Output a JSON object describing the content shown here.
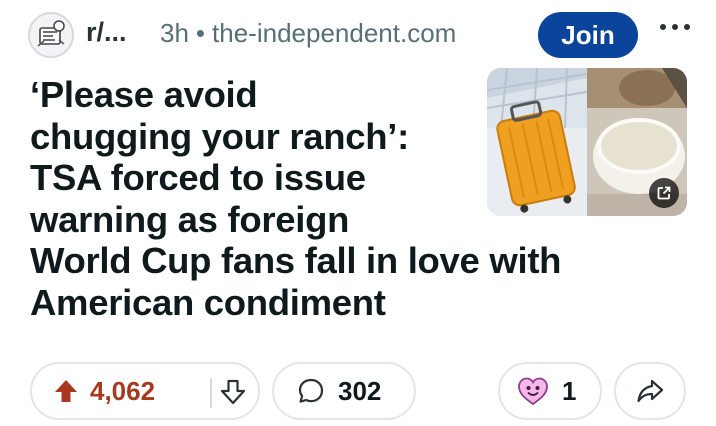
{
  "post": {
    "subreddit": "r/...",
    "age": "3h",
    "separator": "•",
    "domain": "the-independent.com",
    "join_label": "Join",
    "title_lines": [
      "‘Please avoid",
      "chugging your ranch’:",
      "TSA forced to issue",
      "warning as foreign",
      "World Cup fans fall in love with",
      "American condiment"
    ]
  },
  "actions": {
    "upvotes": "4,062",
    "comments": "302",
    "awards": "1"
  },
  "colors": {
    "join_bg": "#0a449b",
    "upvote_accent": "#a9391e",
    "pill_border": "#e3e6e8",
    "meta_text": "#576f76"
  },
  "icons": {
    "subreddit_avatar": "subreddit-avatar-icon",
    "more": "more-dots-icon",
    "external_link": "external-link-icon",
    "upvote": "upvote-arrow-icon",
    "downvote": "downvote-arrow-icon",
    "comment": "comment-bubble-icon",
    "award": "award-heart-icon",
    "share": "share-arrow-icon"
  }
}
